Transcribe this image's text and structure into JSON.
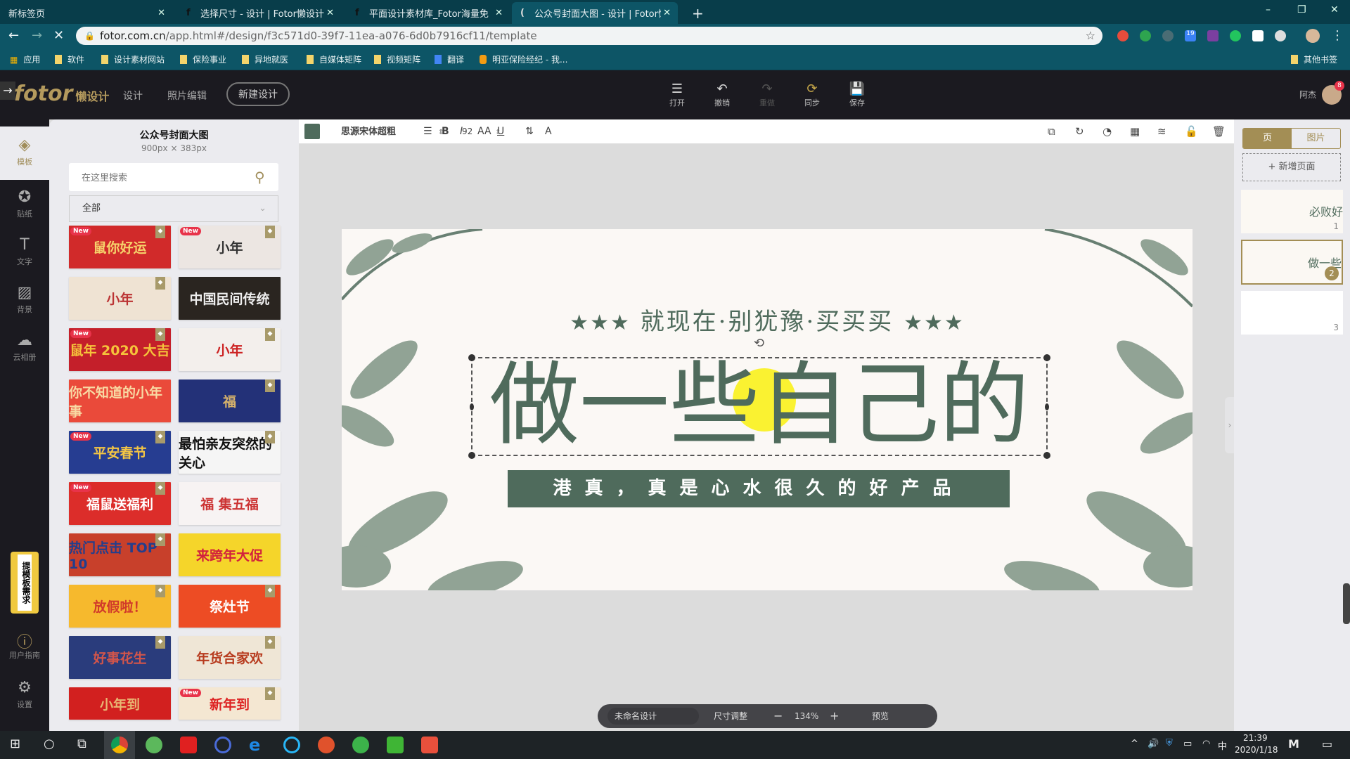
{
  "browser": {
    "tabs": [
      {
        "title": "新标签页",
        "active": false
      },
      {
        "title": "选择尺寸 - 设计 | Fotor懒设计",
        "active": false
      },
      {
        "title": "平面设计素材库_Fotor海量免费",
        "active": false
      },
      {
        "title": "公众号封面大图 - 设计 | Fotor懒",
        "active": true
      }
    ],
    "new_tab": "+",
    "url_host": "fotor.com.cn",
    "url_path": "/app.html#/design/f3c571d0-39f7-11ea-a076-6d0b7916cf11/template",
    "bookmarks": [
      "应用",
      "软件",
      "设计素材网站",
      "保险事业",
      "异地就医",
      "自媒体矩阵",
      "视频矩阵",
      "翻译",
      "明亚保险经纪 - 我..."
    ],
    "other_bookmarks": "其他书签",
    "ext_badge": "19"
  },
  "app": {
    "logo": "fotor",
    "logo_sub": "懒设计",
    "nav": [
      "设计",
      "照片编辑"
    ],
    "new_design": "新建设计",
    "actions": [
      {
        "label": "打开",
        "icon": "menu-icon"
      },
      {
        "label": "撤销",
        "icon": "undo-icon"
      },
      {
        "label": "重做",
        "icon": "redo-icon",
        "disabled": true
      },
      {
        "label": "同步",
        "icon": "sync-icon"
      },
      {
        "label": "保存",
        "icon": "save-icon"
      }
    ],
    "user": "阿杰",
    "notif": "8"
  },
  "rail": {
    "items": [
      {
        "label": "模板",
        "icon": "layers-icon",
        "active": true
      },
      {
        "label": "贴纸",
        "icon": "star-icon"
      },
      {
        "label": "文字",
        "icon": "text-icon"
      },
      {
        "label": "背景",
        "icon": "background-icon"
      },
      {
        "label": "云相册",
        "icon": "cloud-upload-icon"
      }
    ],
    "request": "提模板需求",
    "guide": "用户指南",
    "settings": "设置"
  },
  "sidebar": {
    "title": "公众号封面大图",
    "size": "900px × 383px",
    "search_placeholder": "在这里搜索",
    "category": "全部",
    "thumbnails": [
      {
        "text": "鼠你好运",
        "bg": "#d12a2a",
        "fg": "#f6d36b",
        "new": true,
        "premium": true
      },
      {
        "text": "小年",
        "bg": "#ece6e2",
        "fg": "#333",
        "new": true,
        "premium": true
      },
      {
        "text": "小年",
        "bg": "#efe3d3",
        "fg": "#b33",
        "new": false,
        "premium": true
      },
      {
        "text": "中国民间传统",
        "bg": "#2a2520",
        "fg": "#eee",
        "new": false,
        "premium": false
      },
      {
        "text": "鼠年 2020 大吉",
        "bg": "#c41f2a",
        "fg": "#f5c33b",
        "new": true,
        "premium": true
      },
      {
        "text": "小年",
        "bg": "#f3efec",
        "fg": "#c22",
        "new": false,
        "premium": true
      },
      {
        "text": "你不知道的小年事",
        "bg": "#ea4a3a",
        "fg": "#f8d9a3",
        "new": false,
        "premium": false
      },
      {
        "text": "福",
        "bg": "#233178",
        "fg": "#d7b26b",
        "new": false,
        "premium": true
      },
      {
        "text": "平安春节",
        "bg": "#263d91",
        "fg": "#f4c544",
        "new": true,
        "premium": true
      },
      {
        "text": "最怕亲友突然的关心",
        "bg": "#f5f5f5",
        "fg": "#111",
        "new": false,
        "premium": true
      },
      {
        "text": "福鼠送福利",
        "bg": "#dc2d2a",
        "fg": "#fff",
        "new": true,
        "premium": true
      },
      {
        "text": "福 集五福",
        "bg": "#f7f3f3",
        "fg": "#c33",
        "new": false,
        "premium": false
      },
      {
        "text": "热门点击 TOP 10",
        "bg": "#c8402b",
        "fg": "#233e8c",
        "new": false,
        "premium": true
      },
      {
        "text": "来跨年大促",
        "bg": "#f5d52a",
        "fg": "#d2213d",
        "new": false,
        "premium": false
      },
      {
        "text": "放假啦！",
        "bg": "#f6b92d",
        "fg": "#d13a2a",
        "new": false,
        "premium": true
      },
      {
        "text": "祭灶节",
        "bg": "#ed4c24",
        "fg": "#fff",
        "new": false,
        "premium": true
      },
      {
        "text": "好事花生",
        "bg": "#2a3c7c",
        "fg": "#d2554b",
        "new": false,
        "premium": true
      },
      {
        "text": "年货合家欢",
        "bg": "#efe6d6",
        "fg": "#b73b1e",
        "new": false,
        "premium": true
      },
      {
        "text": "小年到",
        "bg": "#d2201f",
        "fg": "#e8b673",
        "new": false,
        "premium": false
      },
      {
        "text": "新年到",
        "bg": "#f4e7d2",
        "fg": "#d22",
        "new": true,
        "premium": true
      }
    ]
  },
  "toolbar": {
    "color": "#4f6b5c",
    "font": "思源宋体超粗",
    "font_size": "92",
    "format": [
      {
        "label": "☰",
        "icon": "align-icon"
      },
      {
        "label": "B",
        "icon": "bold-icon"
      },
      {
        "label": "I",
        "icon": "italic-icon"
      },
      {
        "label": "AA",
        "icon": "letter-case-icon"
      },
      {
        "label": "U",
        "icon": "underline-icon"
      },
      {
        "label": "⇅",
        "icon": "spacing-icon"
      },
      {
        "label": "A",
        "icon": "text-effect-icon"
      }
    ],
    "right": [
      {
        "label": "⧉",
        "icon": "duplicate-icon"
      },
      {
        "label": "↻",
        "icon": "rotate-icon"
      },
      {
        "label": "◔",
        "icon": "shadow-icon"
      },
      {
        "label": "▦",
        "icon": "transparency-icon"
      },
      {
        "label": "≋",
        "icon": "layer-icon"
      },
      {
        "label": "🔓",
        "icon": "lock-icon"
      },
      {
        "label": "🗑",
        "icon": "delete-icon"
      }
    ]
  },
  "canvas": {
    "stars": "★★★",
    "headline": "就现在·别犹豫·买买买",
    "main": "做一些自己的",
    "bar": "港真，真是心水很久的好产品",
    "accent": "#4f6b5c"
  },
  "pages": {
    "tabs": [
      "页",
      "图片"
    ],
    "add": "+ 新增页面",
    "items": [
      {
        "title": "必败好物推荐",
        "num": "1"
      },
      {
        "title": "做一些自己的",
        "num": "2",
        "selected": true
      },
      {
        "title": "",
        "num": "3"
      }
    ]
  },
  "zoombar": {
    "name": "未命名设计",
    "resize": "尺寸调整",
    "minus": "−",
    "zoom": "134%",
    "plus": "+",
    "preview": "预览"
  },
  "taskbar": {
    "time": "21:39",
    "date": "2020/1/18",
    "ime": "中"
  }
}
